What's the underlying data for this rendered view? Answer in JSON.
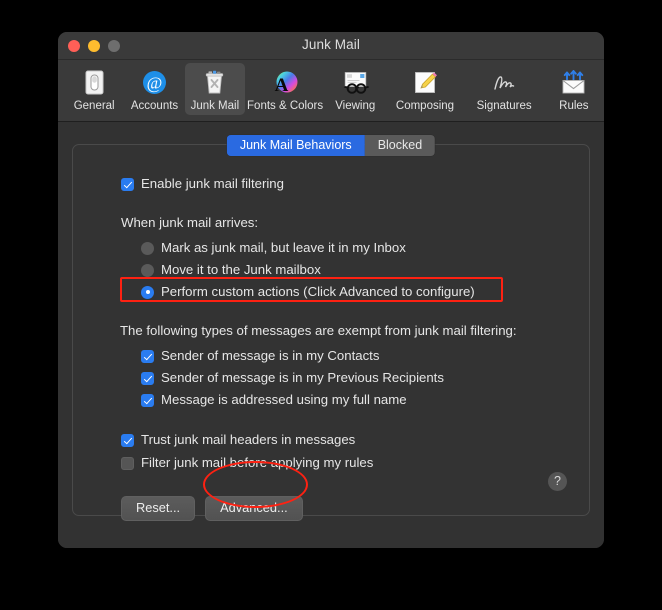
{
  "window": {
    "title": "Junk Mail",
    "traffic_lights": [
      {
        "name": "close",
        "color": "#ff5f57"
      },
      {
        "name": "minimize",
        "color": "#febc2e"
      },
      {
        "name": "zoom",
        "color": "#6e6e6e"
      }
    ]
  },
  "toolbar": {
    "items": [
      {
        "label": "General",
        "icon": "general-icon"
      },
      {
        "label": "Accounts",
        "icon": "at-sign-icon"
      },
      {
        "label": "Junk Mail",
        "icon": "trash-junk-icon",
        "selected": true
      },
      {
        "label": "Fonts & Colors",
        "icon": "font-color-wheel-icon"
      },
      {
        "label": "Viewing",
        "icon": "glasses-icon"
      },
      {
        "label": "Composing",
        "icon": "pencil-note-icon"
      },
      {
        "label": "Signatures",
        "icon": "signature-icon"
      },
      {
        "label": "Rules",
        "icon": "envelope-arrows-icon"
      }
    ]
  },
  "tabs": {
    "items": [
      {
        "label": "Junk Mail Behaviors",
        "active": true
      },
      {
        "label": "Blocked",
        "active": false
      }
    ]
  },
  "main": {
    "enable_filtering": {
      "label": "Enable junk mail filtering",
      "checked": true
    },
    "arrives_heading": "When junk mail arrives:",
    "arrives_options": [
      {
        "label": "Mark as junk mail, but leave it in my Inbox",
        "selected": false
      },
      {
        "label": "Move it to the Junk mailbox",
        "selected": false
      },
      {
        "label": "Perform custom actions (Click Advanced to configure)",
        "selected": true
      }
    ],
    "exempt_heading": "The following types of messages are exempt from junk mail filtering:",
    "exempt_options": [
      {
        "label": "Sender of message is in my Contacts",
        "checked": true
      },
      {
        "label": "Sender of message is in my Previous Recipients",
        "checked": true
      },
      {
        "label": "Message is addressed using my full name",
        "checked": true
      }
    ],
    "extra_options": [
      {
        "label": "Trust junk mail headers in messages",
        "checked": true
      },
      {
        "label": "Filter junk mail before applying my rules",
        "checked": false
      }
    ],
    "buttons": {
      "reset": "Reset...",
      "advanced": "Advanced...",
      "help": "?"
    }
  },
  "annotations": {
    "highlight_color": "#fe2112",
    "items": [
      {
        "name": "highlight-perform-custom-actions",
        "shape": "rectangle"
      },
      {
        "name": "highlight-advanced-button",
        "shape": "ellipse"
      }
    ]
  }
}
